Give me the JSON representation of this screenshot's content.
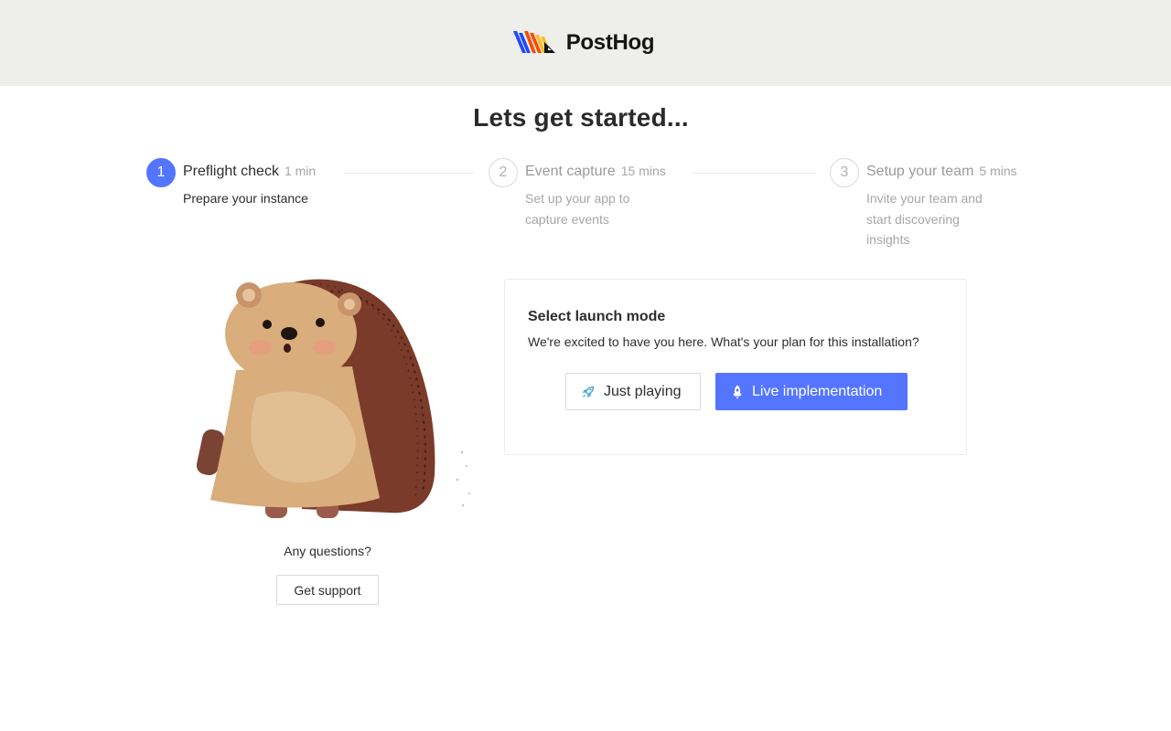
{
  "header": {
    "brand": "PostHog",
    "brand_colors": [
      "#1d4aff",
      "#f54e00",
      "#f9bd2b",
      "#000000"
    ]
  },
  "page": {
    "title": "Lets get started..."
  },
  "steps": [
    {
      "number": "1",
      "title": "Preflight check",
      "time": "1 min",
      "description": "Prepare your instance",
      "active": true
    },
    {
      "number": "2",
      "title": "Event capture",
      "time": "15 mins",
      "description": "Set up your app to capture events",
      "active": false
    },
    {
      "number": "3",
      "title": "Setup your team",
      "time": "5 mins",
      "description": "Invite your team and start discovering insights",
      "active": false
    }
  ],
  "support": {
    "question": "Any questions?",
    "button_label": "Get support"
  },
  "launch_card": {
    "title": "Select launch mode",
    "subtitle": "We're excited to have you here. What's your plan for this installation?",
    "options": [
      {
        "label": "Just playing",
        "icon": "rocket-outline-icon"
      },
      {
        "label": "Live implementation",
        "icon": "rocket-icon"
      }
    ]
  },
  "colors": {
    "accent": "#5375ff",
    "topbar_bg": "#eeeeea"
  }
}
